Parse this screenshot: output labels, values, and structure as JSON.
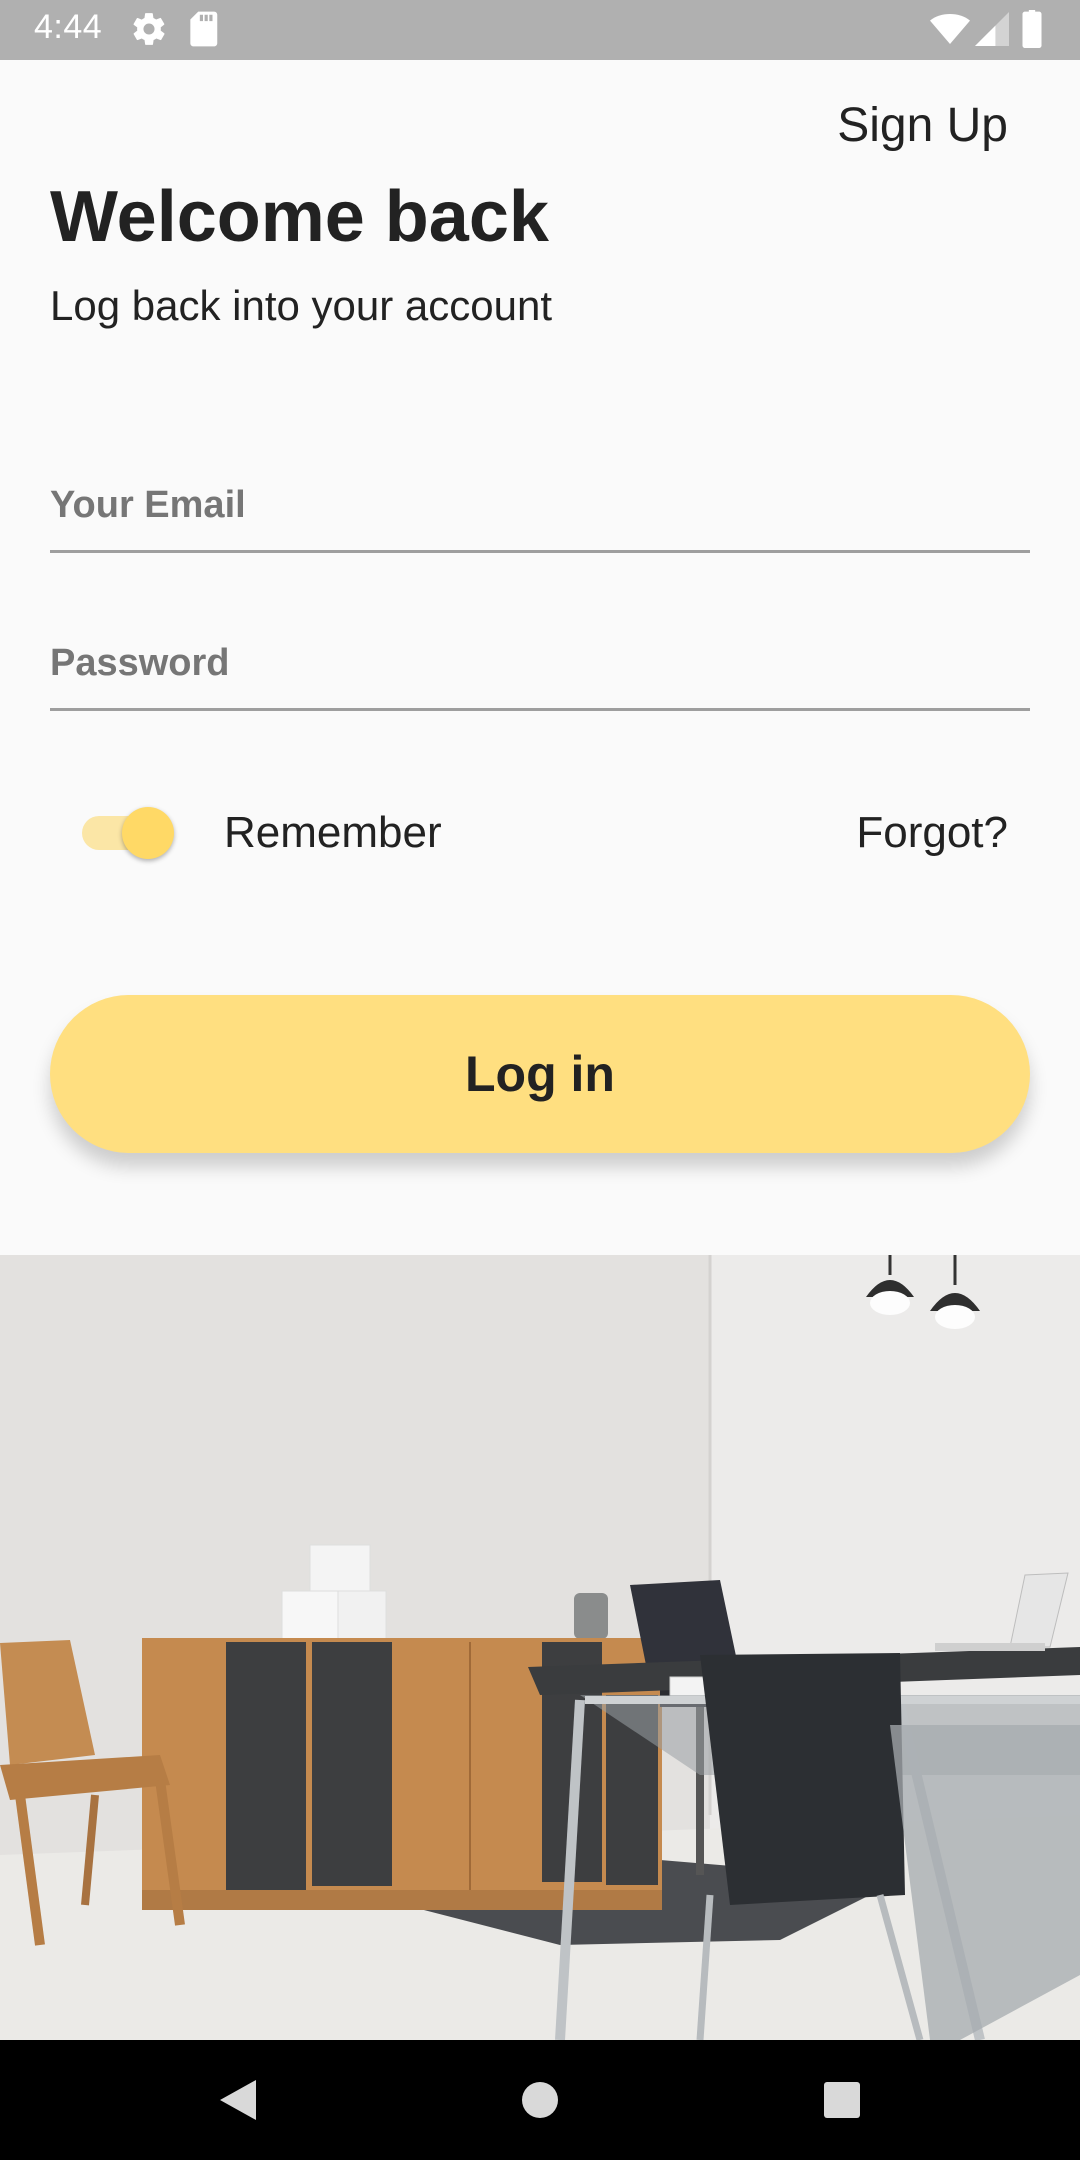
{
  "status_bar": {
    "time": "4:44",
    "icons_left": [
      "settings-icon",
      "sd-card-icon"
    ],
    "icons_right": [
      "wifi-icon",
      "signal-icon",
      "battery-icon"
    ]
  },
  "header": {
    "sign_up_label": "Sign Up",
    "title": "Welcome back",
    "subtitle": "Log back into your account"
  },
  "form": {
    "email_placeholder": "Your Email",
    "email_value": "",
    "password_placeholder": "Password",
    "password_value": "",
    "remember_label": "Remember",
    "remember_on": true,
    "forgot_label": "Forgot?",
    "login_label": "Log in"
  },
  "hero_image": "office-interior-photo",
  "nav_bar": {
    "buttons": [
      "back-icon",
      "home-icon",
      "recents-icon"
    ]
  },
  "colors": {
    "accent": "#ffdf80",
    "toggle_thumb": "#ffd966",
    "toggle_track": "#fbe6a6",
    "background": "#fafafa",
    "status_bar": "#b0b0b0",
    "text": "#222222"
  }
}
